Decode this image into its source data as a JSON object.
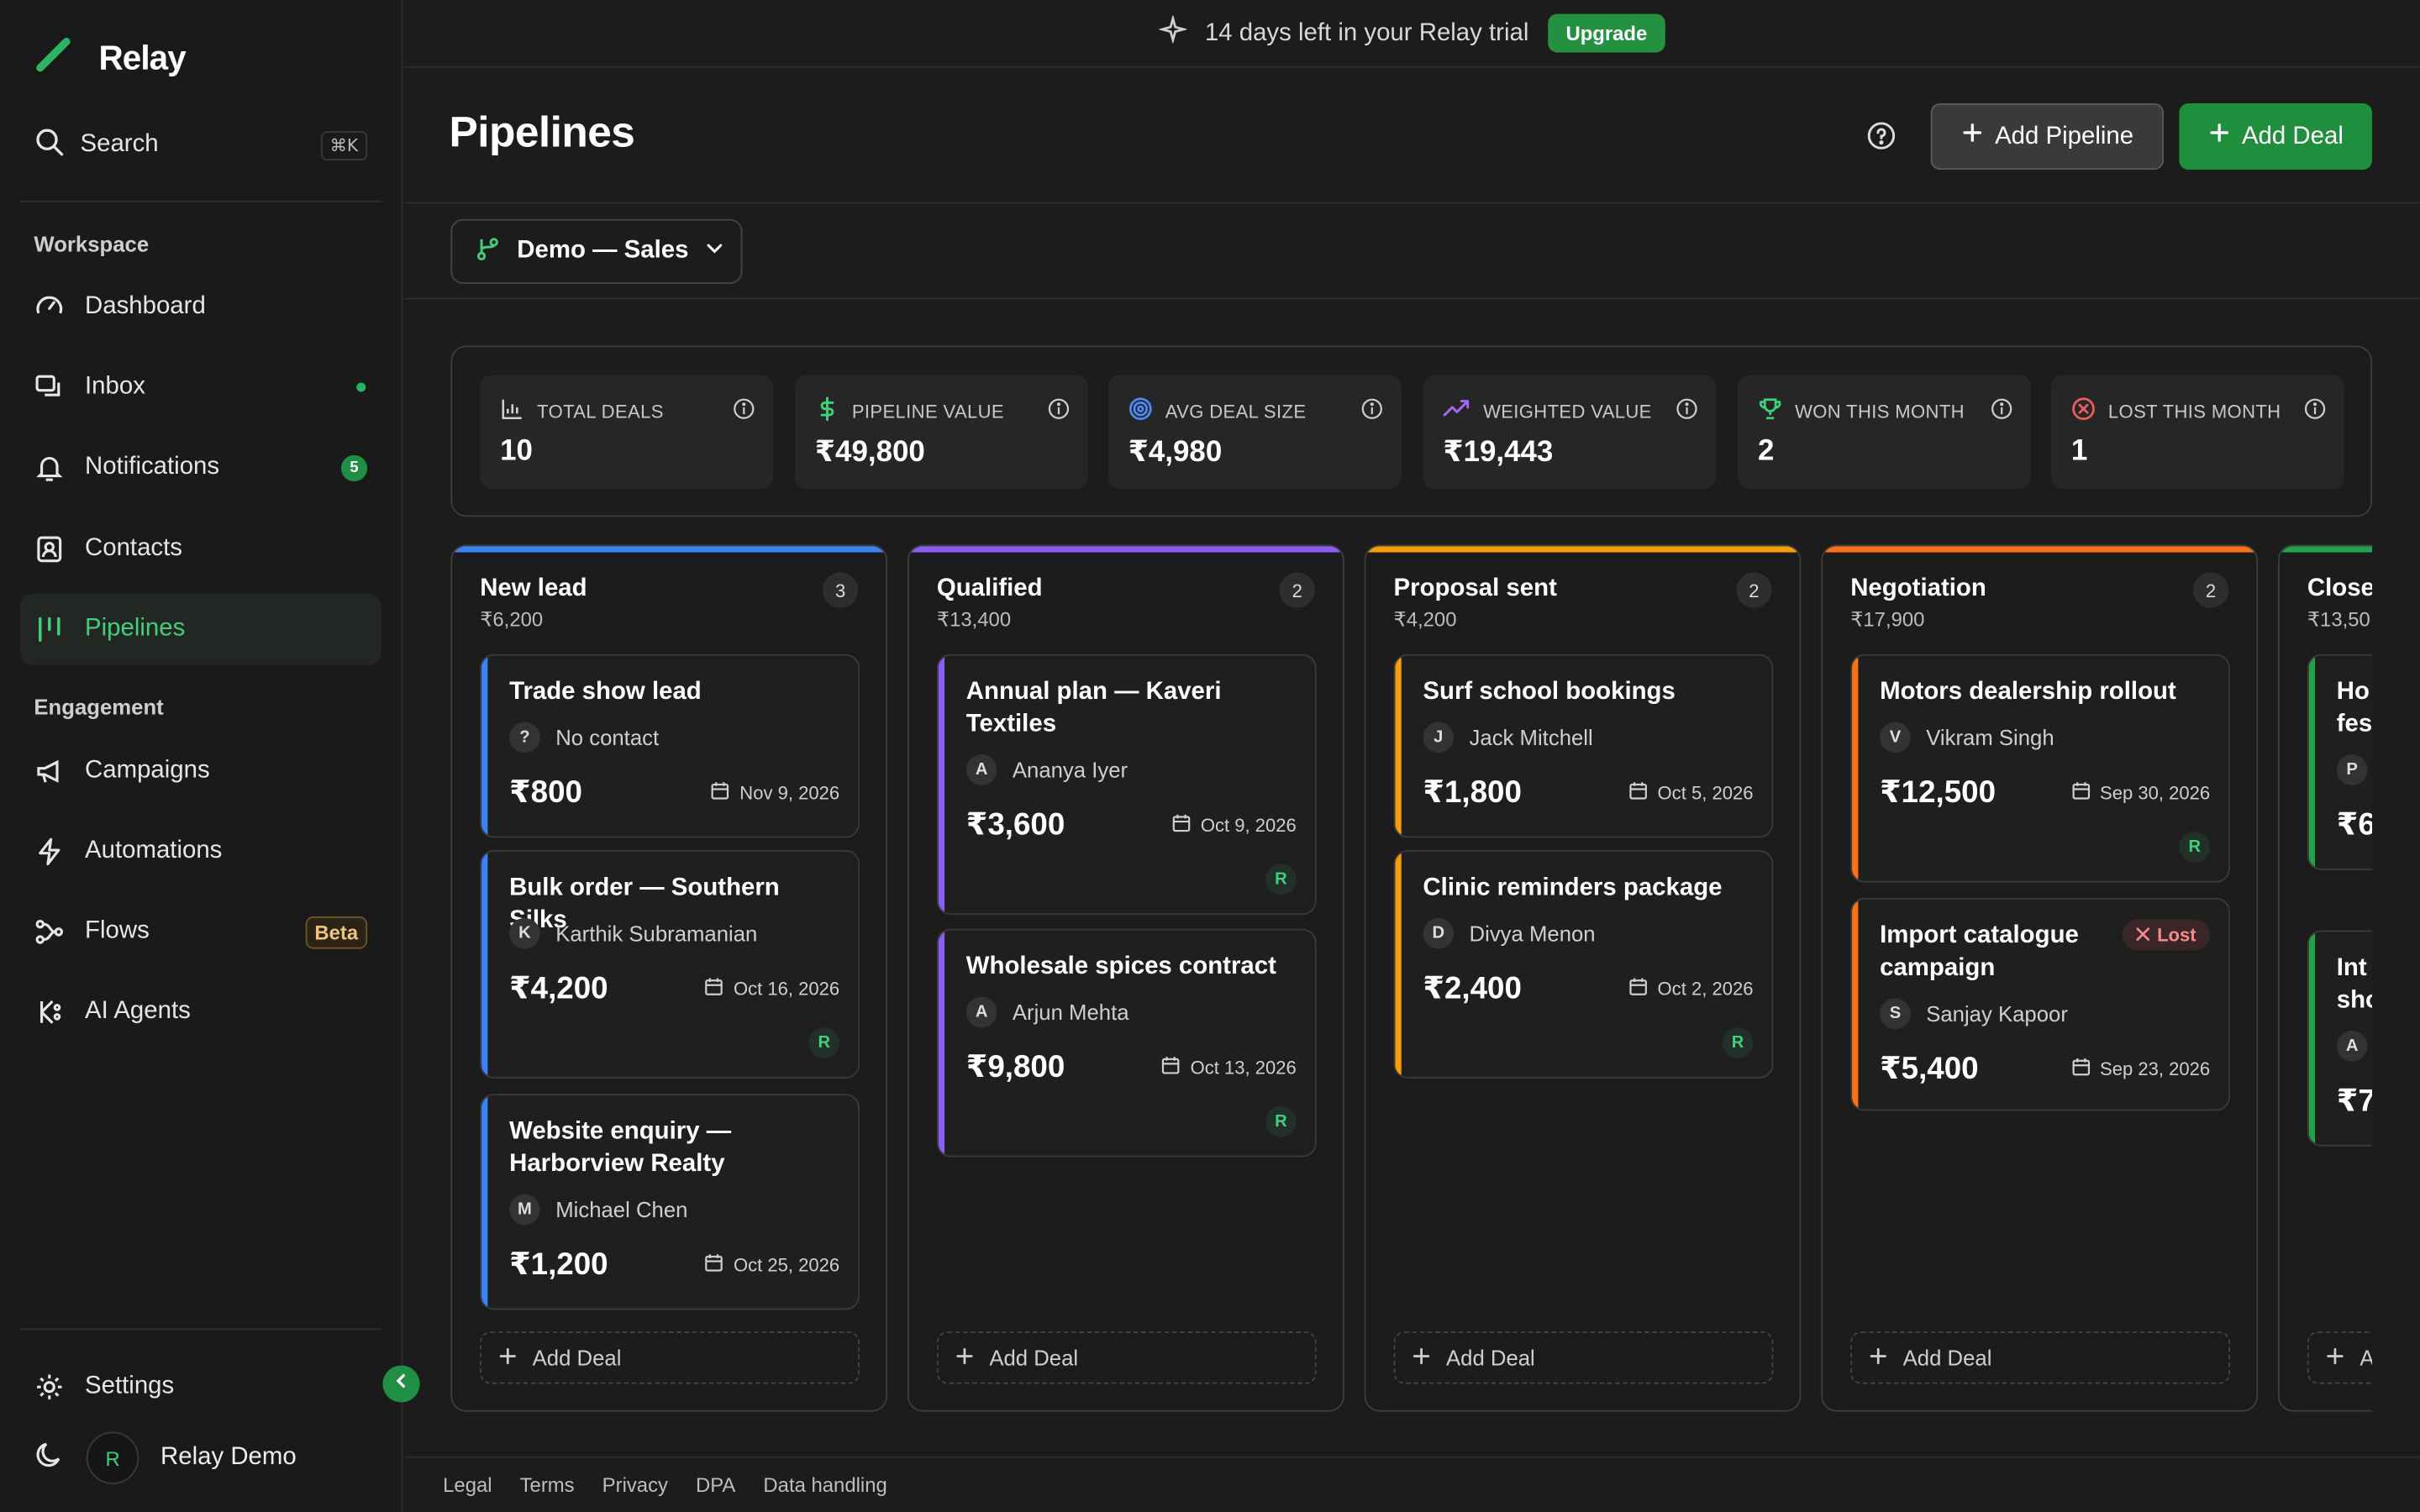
{
  "app": {
    "name": "Relay"
  },
  "colors": {
    "accent": "#1f8f3d",
    "new_lead": "#3b82f6",
    "qualified": "#8b5cf6",
    "proposal_sent": "#f59e0b",
    "negotiation": "#f97316",
    "closed": "#22a34a"
  },
  "sidebar": {
    "search": {
      "label": "Search",
      "shortcut": "⌘K"
    },
    "workspace_label": "Workspace",
    "engagement_label": "Engagement",
    "workspace_items": [
      {
        "label": "Dashboard",
        "icon": "dashboard-icon"
      },
      {
        "label": "Inbox",
        "icon": "inbox-icon"
      },
      {
        "label": "Notifications",
        "icon": "bell-icon",
        "badge": "5"
      },
      {
        "label": "Contacts",
        "icon": "contacts-icon"
      },
      {
        "label": "Pipelines",
        "icon": "pipeline-icon",
        "active": true
      }
    ],
    "engagement_items": [
      {
        "label": "Campaigns",
        "icon": "megaphone-icon"
      },
      {
        "label": "Automations",
        "icon": "bolt-icon"
      },
      {
        "label": "Flows",
        "icon": "flows-icon",
        "badge": "Beta"
      },
      {
        "label": "AI Agents",
        "icon": "ai-agent-icon"
      }
    ],
    "settings_label": "Settings",
    "user": {
      "initial": "R",
      "name": "Relay Demo"
    }
  },
  "trial": {
    "text": "14 days left in your Relay trial",
    "button": "Upgrade"
  },
  "header": {
    "title": "Pipelines",
    "add_pipeline": "Add Pipeline",
    "add_deal": "Add Deal"
  },
  "pipeline_select": {
    "value": "Demo — Sales"
  },
  "stats": [
    {
      "label": "TOTAL DEALS",
      "value": "10",
      "icon": "bar-chart-icon"
    },
    {
      "label": "PIPELINE VALUE",
      "value": "₹49,800",
      "icon": "dollar-icon"
    },
    {
      "label": "AVG DEAL SIZE",
      "value": "₹4,980",
      "icon": "target-icon"
    },
    {
      "label": "WEIGHTED VALUE",
      "value": "₹19,443",
      "icon": "trending-up-icon"
    },
    {
      "label": "WON THIS MONTH",
      "value": "2",
      "icon": "trophy-icon"
    },
    {
      "label": "LOST THIS MONTH",
      "value": "1",
      "icon": "x-circle-icon"
    }
  ],
  "columns": [
    {
      "title": "New lead",
      "sum": "₹6,200",
      "count": "3",
      "deals": [
        {
          "title": "Trade show lead",
          "contact_initial": "?",
          "contact": "No contact",
          "amount": "₹800",
          "date": "Nov 9, 2026",
          "owner": ""
        },
        {
          "title": "Bulk order — Southern Silks",
          "contact_initial": "K",
          "contact": "Karthik Subramanian",
          "amount": "₹4,200",
          "date": "Oct 16, 2026",
          "owner": "R"
        },
        {
          "title": "Website enquiry — Harborview Realty",
          "contact_initial": "M",
          "contact": "Michael Chen",
          "amount": "₹1,200",
          "date": "Oct 25, 2026",
          "owner": ""
        }
      ]
    },
    {
      "title": "Qualified",
      "sum": "₹13,400",
      "count": "2",
      "deals": [
        {
          "title": "Annual plan — Kaveri Textiles",
          "contact_initial": "A",
          "contact": "Ananya Iyer",
          "amount": "₹3,600",
          "date": "Oct 9, 2026",
          "owner": "R"
        },
        {
          "title": "Wholesale spices contract",
          "contact_initial": "A",
          "contact": "Arjun Mehta",
          "amount": "₹9,800",
          "date": "Oct 13, 2026",
          "owner": "R"
        }
      ]
    },
    {
      "title": "Proposal sent",
      "sum": "₹4,200",
      "count": "2",
      "deals": [
        {
          "title": "Surf school bookings",
          "contact_initial": "J",
          "contact": "Jack Mitchell",
          "amount": "₹1,800",
          "date": "Oct 5, 2026",
          "owner": ""
        },
        {
          "title": "Clinic reminders package",
          "contact_initial": "D",
          "contact": "Divya Menon",
          "amount": "₹2,400",
          "date": "Oct 2, 2026",
          "owner": "R"
        }
      ]
    },
    {
      "title": "Negotiation",
      "sum": "₹17,900",
      "count": "2",
      "deals": [
        {
          "title": "Motors dealership rollout",
          "contact_initial": "V",
          "contact": "Vikram Singh",
          "amount": "₹12,500",
          "date": "Sep 30, 2026",
          "owner": "R"
        },
        {
          "title": "Import catalogue campaign",
          "contact_initial": "S",
          "contact": "Sanjay Kapoor",
          "amount": "₹5,400",
          "date": "Sep 23, 2026",
          "owner": "",
          "badge": "Lost"
        }
      ]
    },
    {
      "title": "Close",
      "sum": "₹13,50",
      "count": "",
      "deals": [
        {
          "title": "Ho fes",
          "contact_initial": "P",
          "amount": "₹6"
        },
        {
          "title": "Int sho",
          "contact_initial": "A",
          "amount": "₹7,"
        }
      ]
    }
  ],
  "add_deal_label": "Add Deal",
  "add_deal_partial": "A",
  "footer": {
    "links": [
      "Legal",
      "Terms",
      "Privacy",
      "DPA",
      "Data handling"
    ]
  }
}
